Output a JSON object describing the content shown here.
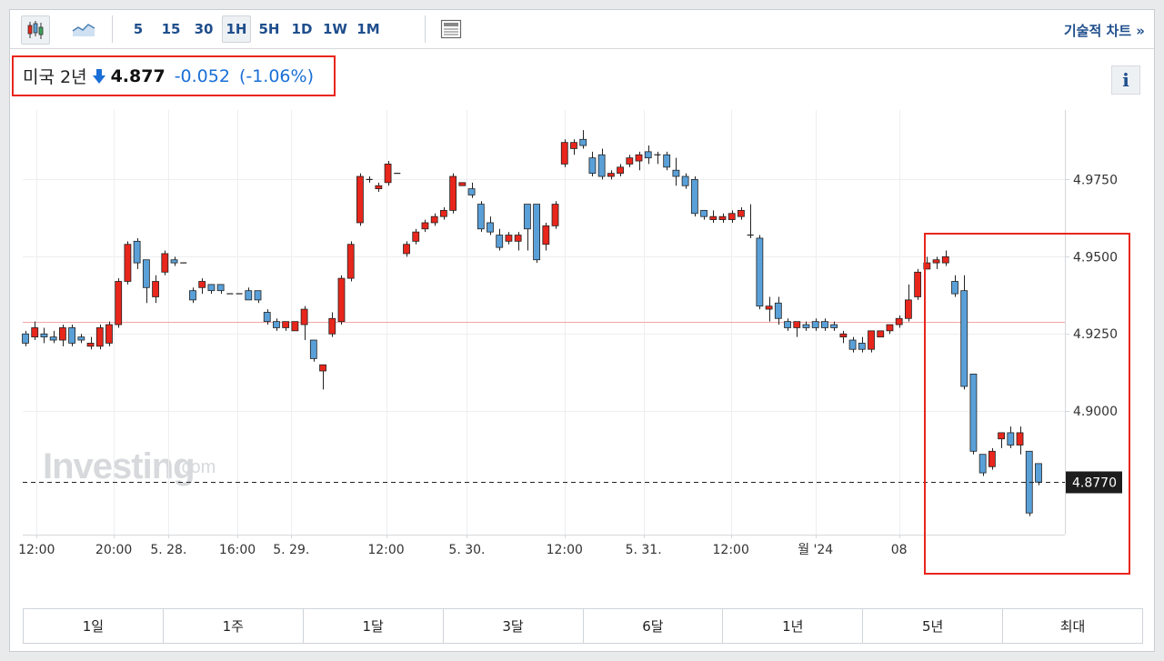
{
  "toolbar": {
    "intervals": [
      "5",
      "15",
      "30",
      "1H",
      "5H",
      "1D",
      "1W",
      "1M"
    ],
    "active_interval": "1H",
    "tech_chart_label": "기술적 차트 »",
    "icons": [
      "candlestick-icon",
      "area-chart-icon",
      "news-icon"
    ]
  },
  "quote": {
    "name": "미국 2년",
    "direction": "down",
    "price": "4.877",
    "change": "-0.052",
    "change_pct": "(-1.06%)"
  },
  "info_label": "i",
  "watermark": {
    "brand": "Investing",
    "suffix": ".com"
  },
  "ranges": [
    "1일",
    "1주",
    "1달",
    "3달",
    "6달",
    "1년",
    "5년",
    "최대"
  ],
  "colors": {
    "up": "#e8261c",
    "down": "#5aa0d8",
    "accent": "#1f4e8c",
    "change": "#1a6fd6"
  },
  "chart_data": {
    "type": "candlestick",
    "ylim": [
      4.86,
      4.9975
    ],
    "y_ticks": [
      "4.9750",
      "4.9500",
      "4.9250",
      "4.9000"
    ],
    "y_tick_values": [
      4.975,
      4.95,
      4.925,
      4.9
    ],
    "last_price_label": "4.8770",
    "last_price": 4.877,
    "previous_close": 4.929,
    "x_ticks": [
      "12:00",
      "20:00",
      "5. 28.",
      "16:00",
      "5. 29.",
      "12:00",
      "5. 30.",
      "12:00",
      "5. 31.",
      "12:00",
      "월 '24",
      "08"
    ],
    "x_tick_index": [
      1.2,
      9.5,
      15.4,
      22.8,
      28.6,
      38.8,
      47.5,
      58,
      66.5,
      75.9,
      85,
      94
    ],
    "candles": [
      [
        4.925,
        4.926,
        4.921,
        4.922
      ],
      [
        4.924,
        4.929,
        4.923,
        4.927
      ],
      [
        4.925,
        4.927,
        4.922,
        4.924
      ],
      [
        4.924,
        4.926,
        4.922,
        4.923
      ],
      [
        4.923,
        4.928,
        4.921,
        4.927
      ],
      [
        4.927,
        4.928,
        4.921,
        4.922
      ],
      [
        4.924,
        4.925,
        4.922,
        4.923
      ],
      [
        4.921,
        4.924,
        4.92,
        4.922
      ],
      [
        4.921,
        4.928,
        4.92,
        4.927
      ],
      [
        4.922,
        4.929,
        4.921,
        4.928
      ],
      [
        4.928,
        4.943,
        4.927,
        4.942
      ],
      [
        4.942,
        4.955,
        4.941,
        4.954
      ],
      [
        4.955,
        4.956,
        4.946,
        4.948
      ],
      [
        4.949,
        4.949,
        4.935,
        4.94
      ],
      [
        4.937,
        4.944,
        4.935,
        4.942
      ],
      [
        4.945,
        4.952,
        4.944,
        4.951
      ],
      [
        4.949,
        4.95,
        4.947,
        4.948
      ],
      [
        4.948,
        4.948,
        4.948,
        4.948
      ],
      [
        4.939,
        4.94,
        4.935,
        4.936
      ],
      [
        4.94,
        4.943,
        4.938,
        4.942
      ],
      [
        4.941,
        4.941,
        4.938,
        4.939
      ],
      [
        4.941,
        4.941,
        4.938,
        4.939
      ],
      [
        4.938,
        4.938,
        4.938,
        4.938
      ],
      [
        4.938,
        4.938,
        4.938,
        4.938
      ],
      [
        4.939,
        4.94,
        4.936,
        4.936
      ],
      [
        4.939,
        4.939,
        4.935,
        4.936
      ],
      [
        4.932,
        4.933,
        4.928,
        4.929
      ],
      [
        4.929,
        4.93,
        4.926,
        4.927
      ],
      [
        4.927,
        4.929,
        4.926,
        4.929
      ],
      [
        4.926,
        4.929,
        4.926,
        4.929
      ],
      [
        4.928,
        4.934,
        4.923,
        4.933
      ],
      [
        4.923,
        4.923,
        4.916,
        4.917
      ],
      [
        4.913,
        4.913,
        4.907,
        4.915
      ],
      [
        4.925,
        4.932,
        4.924,
        4.93
      ],
      [
        4.929,
        4.944,
        4.928,
        4.943
      ],
      [
        4.943,
        4.955,
        4.942,
        4.954
      ],
      [
        4.961,
        4.977,
        4.96,
        4.976
      ],
      [
        4.975,
        4.976,
        4.974,
        4.975
      ],
      [
        4.972,
        4.974,
        4.971,
        4.973
      ],
      [
        4.974,
        4.981,
        4.973,
        4.98
      ],
      [
        4.977,
        4.977,
        4.977,
        4.977
      ],
      [
        4.951,
        4.955,
        4.95,
        4.954
      ],
      [
        4.955,
        4.959,
        4.954,
        4.958
      ],
      [
        4.959,
        4.962,
        4.958,
        4.961
      ],
      [
        4.961,
        4.964,
        4.96,
        4.963
      ],
      [
        4.963,
        4.966,
        4.962,
        4.965
      ],
      [
        4.965,
        4.977,
        4.964,
        4.976
      ],
      [
        4.973,
        4.974,
        4.973,
        4.974
      ],
      [
        4.972,
        4.974,
        4.969,
        4.97
      ],
      [
        4.967,
        4.968,
        4.958,
        4.959
      ],
      [
        4.961,
        4.963,
        4.957,
        4.958
      ],
      [
        4.957,
        4.959,
        4.952,
        4.953
      ],
      [
        4.955,
        4.958,
        4.954,
        4.957
      ],
      [
        4.955,
        4.958,
        4.952,
        4.957
      ],
      [
        4.967,
        4.967,
        4.952,
        4.959
      ],
      [
        4.967,
        4.967,
        4.948,
        4.949
      ],
      [
        4.954,
        4.961,
        4.952,
        4.96
      ],
      [
        4.96,
        4.968,
        4.959,
        4.967
      ],
      [
        4.98,
        4.988,
        4.979,
        4.987
      ],
      [
        4.985,
        4.988,
        4.983,
        4.987
      ],
      [
        4.988,
        4.991,
        4.985,
        4.986
      ],
      [
        4.982,
        4.984,
        4.976,
        4.977
      ],
      [
        4.983,
        4.985,
        4.975,
        4.976
      ],
      [
        4.976,
        4.978,
        4.975,
        4.977
      ],
      [
        4.977,
        4.98,
        4.976,
        4.979
      ],
      [
        4.98,
        4.983,
        4.979,
        4.982
      ],
      [
        4.981,
        4.984,
        4.978,
        4.983
      ],
      [
        4.984,
        4.986,
        4.98,
        4.982
      ],
      [
        4.983,
        4.984,
        4.98,
        4.983
      ],
      [
        4.983,
        4.984,
        4.978,
        4.979
      ],
      [
        4.978,
        4.982,
        4.973,
        4.976
      ],
      [
        4.976,
        4.977,
        4.972,
        4.973
      ],
      [
        4.975,
        4.976,
        4.963,
        4.964
      ],
      [
        4.965,
        4.965,
        4.962,
        4.963
      ],
      [
        4.962,
        4.965,
        4.961,
        4.963
      ],
      [
        4.962,
        4.964,
        4.961,
        4.963
      ],
      [
        4.962,
        4.965,
        4.961,
        4.964
      ],
      [
        4.963,
        4.966,
        4.962,
        4.965
      ],
      [
        4.957,
        4.967,
        4.956,
        4.957
      ],
      [
        4.956,
        4.957,
        4.933,
        4.934
      ],
      [
        4.933,
        4.937,
        4.929,
        4.934
      ],
      [
        4.935,
        4.937,
        4.928,
        4.93
      ],
      [
        4.929,
        4.93,
        4.926,
        4.927
      ],
      [
        4.927,
        4.929,
        4.924,
        4.929
      ],
      [
        4.928,
        4.929,
        4.926,
        4.927
      ],
      [
        4.929,
        4.93,
        4.926,
        4.927
      ],
      [
        4.929,
        4.93,
        4.926,
        4.927
      ],
      [
        4.928,
        4.929,
        4.926,
        4.927
      ],
      [
        4.924,
        4.926,
        4.922,
        4.925
      ],
      [
        4.923,
        4.924,
        4.919,
        4.92
      ],
      [
        4.922,
        4.924,
        4.919,
        4.92
      ],
      [
        4.92,
        4.926,
        4.919,
        4.926
      ],
      [
        4.924,
        4.926,
        4.924,
        4.926
      ],
      [
        4.926,
        4.928,
        4.925,
        4.928
      ],
      [
        4.928,
        4.931,
        4.927,
        4.93
      ],
      [
        4.93,
        4.941,
        4.929,
        4.936
      ],
      [
        4.937,
        4.946,
        4.936,
        4.945
      ],
      [
        4.946,
        4.95,
        4.946,
        4.948
      ],
      [
        4.948,
        4.95,
        4.946,
        4.949
      ],
      [
        4.948,
        4.952,
        4.947,
        4.95
      ],
      [
        4.942,
        4.944,
        4.937,
        4.938
      ],
      [
        4.939,
        4.944,
        4.907,
        4.908
      ],
      [
        4.912,
        4.912,
        4.886,
        4.887
      ],
      [
        4.886,
        4.886,
        4.879,
        4.88
      ],
      [
        4.882,
        4.888,
        4.881,
        4.887
      ],
      [
        4.891,
        4.893,
        4.888,
        4.893
      ],
      [
        4.893,
        4.895,
        4.888,
        4.889
      ],
      [
        4.889,
        4.895,
        4.886,
        4.893
      ],
      [
        4.887,
        4.887,
        4.866,
        4.867
      ],
      [
        4.883,
        4.883,
        4.876,
        4.877
      ]
    ]
  }
}
